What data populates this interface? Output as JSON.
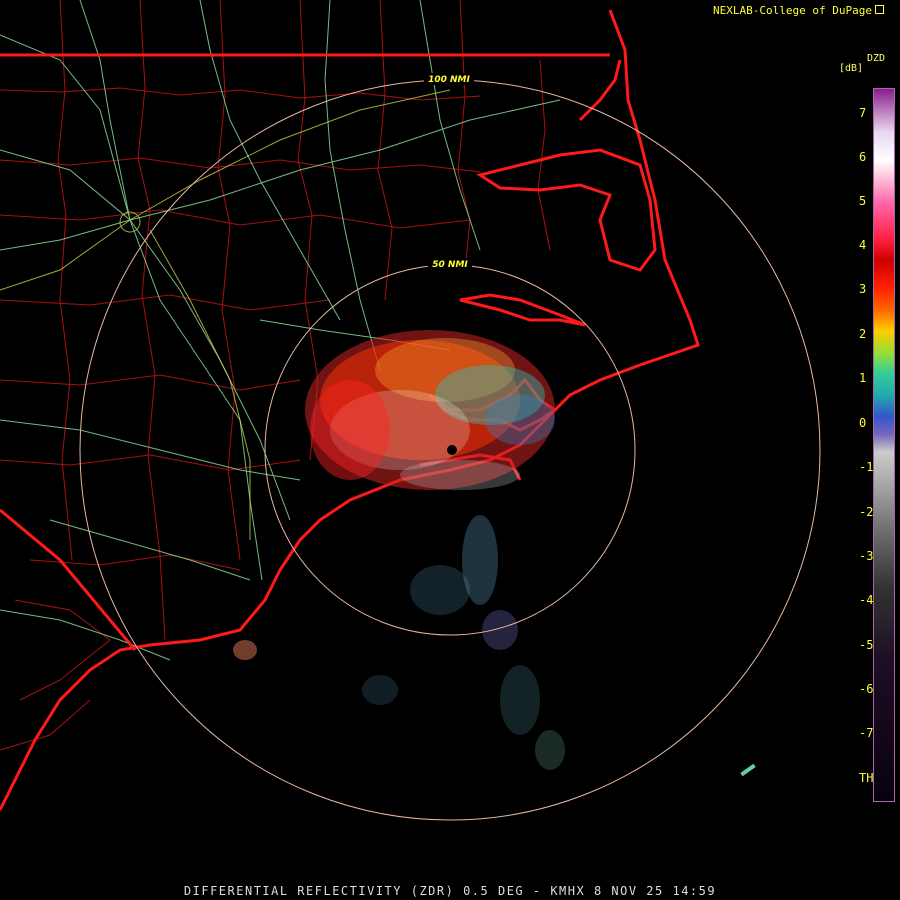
{
  "credit": "NEXLAB-College of DuPage",
  "legend": {
    "product": "DZD",
    "unit": "[dB]",
    "ticks": [
      "7",
      "6",
      "5",
      "4",
      "3",
      "2",
      "1",
      "0",
      "-1",
      "-2",
      "-3",
      "-4",
      "-5",
      "-6",
      "-7",
      "TH"
    ]
  },
  "rings": [
    {
      "label": "100 NMI"
    },
    {
      "label": "50 NMI"
    }
  ],
  "footer": "DIFFERENTIAL REFLECTIVITY (ZDR) 0.5 DEG - KMHX 8 NOV 25 14:59",
  "colors": {
    "background": "#000000",
    "state_borders": "#ff1a1a",
    "county_lines": "#aa1111",
    "highways": "#88dd99",
    "range_rings": "#e8b8a0",
    "labels": "#ffff33"
  }
}
